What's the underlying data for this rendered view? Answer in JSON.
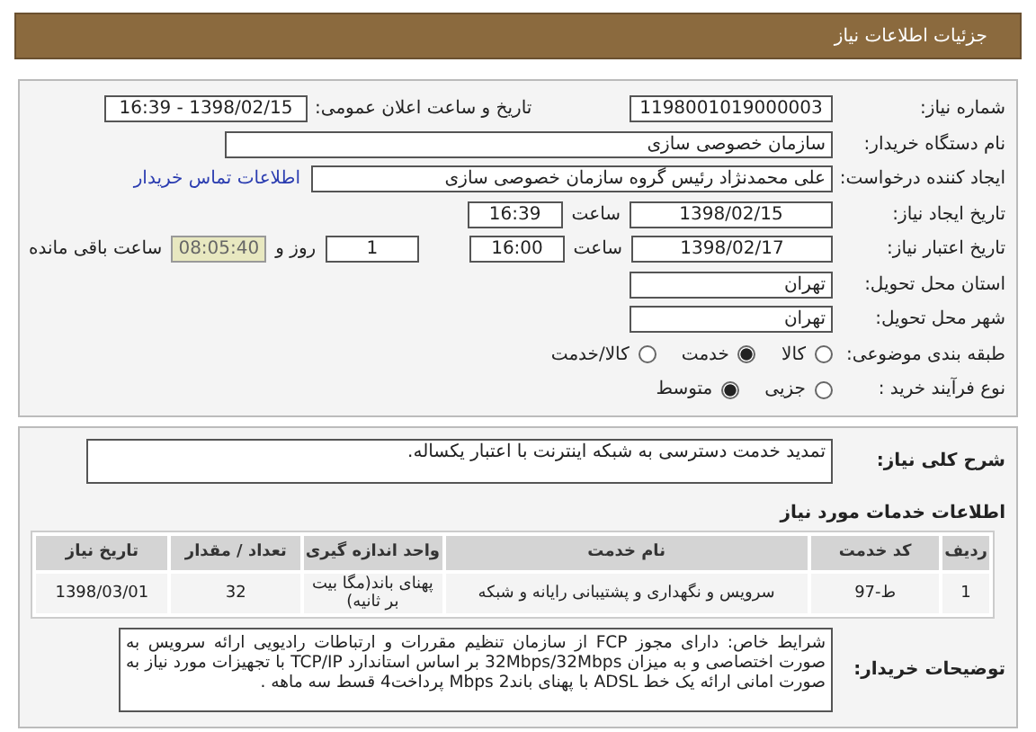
{
  "header": {
    "title": "جزئیات اطلاعات نیاز"
  },
  "fields": [
    {
      "kind": "pair",
      "label": "شماره نیاز:",
      "value": "1198001019000003",
      "label2": "تاریخ و ساعت اعلان عمومی:",
      "value2": "1398/02/15 - 16:39"
    },
    {
      "kind": "wide",
      "label": "نام دستگاه خریدار:",
      "value": "سازمان خصوصی سازی"
    },
    {
      "kind": "link",
      "label": "ایجاد کننده درخواست:",
      "value": "علی محمدنژاد رئیس گروه سازمان خصوصی سازی",
      "link": "اطلاعات تماس خریدار"
    },
    {
      "kind": "datetime",
      "label": "تاریخ ایجاد نیاز:",
      "value": "1398/02/15",
      "time_label": "ساعت",
      "time": "16:39"
    },
    {
      "kind": "deadline",
      "label": "تاریخ اعتبار نیاز:",
      "value": "1398/02/17",
      "time_label": "ساعت",
      "time": "16:00",
      "days": "1",
      "days_label": "روز و",
      "remaining": "08:05:40",
      "remaining_label": "ساعت باقی مانده"
    },
    {
      "kind": "short",
      "label": "استان محل تحویل:",
      "value": "تهران"
    },
    {
      "kind": "short",
      "label": "شهر محل تحویل:",
      "value": "تهران"
    },
    {
      "kind": "radio",
      "label": "طبقه بندی موضوعی:",
      "options": [
        {
          "label": "کالا",
          "selected": false
        },
        {
          "label": "خدمت",
          "selected": true
        },
        {
          "label": "کالا/خدمت",
          "selected": false
        }
      ]
    },
    {
      "kind": "radio",
      "label": "نوع فرآیند خرید :",
      "options": [
        {
          "label": "جزیی",
          "selected": false
        },
        {
          "label": "متوسط",
          "selected": true
        }
      ]
    }
  ],
  "summary": {
    "label": "شرح کلی نیاز:",
    "value": "تمدید خدمت دسترسی به شبکه اینترنت با اعتبار یکساله."
  },
  "services": {
    "heading": "اطلاعات خدمات مورد نیاز",
    "columns": [
      "ردیف",
      "کد خدمت",
      "نام خدمت",
      "واحد اندازه گیری",
      "تعداد / مقدار",
      "تاریخ نیاز"
    ],
    "rows": [
      [
        "1",
        "ط-97",
        "سرویس و نگهداری و پشتیبانی رایانه و شبکه",
        "پهنای باند(مگا بیت بر ثانیه)",
        "32",
        "1398/03/01"
      ]
    ]
  },
  "notes": {
    "label": "توضیحات خریدار:",
    "value": "شرایط خاص: دارای مجوز FCP از سازمان تنظیم مقررات و ارتباطات رادیویی ارائه سرویس به صورت اختصاصی و به میزان 32Mbps/32Mbps بر اساس استاندارد TCP/IP با تجهیزات مورد نیاز به صورت امانی ارائه یک خط ADSL با پهنای باند2 Mbps پرداخت4 قسط سه ماهه ."
  }
}
